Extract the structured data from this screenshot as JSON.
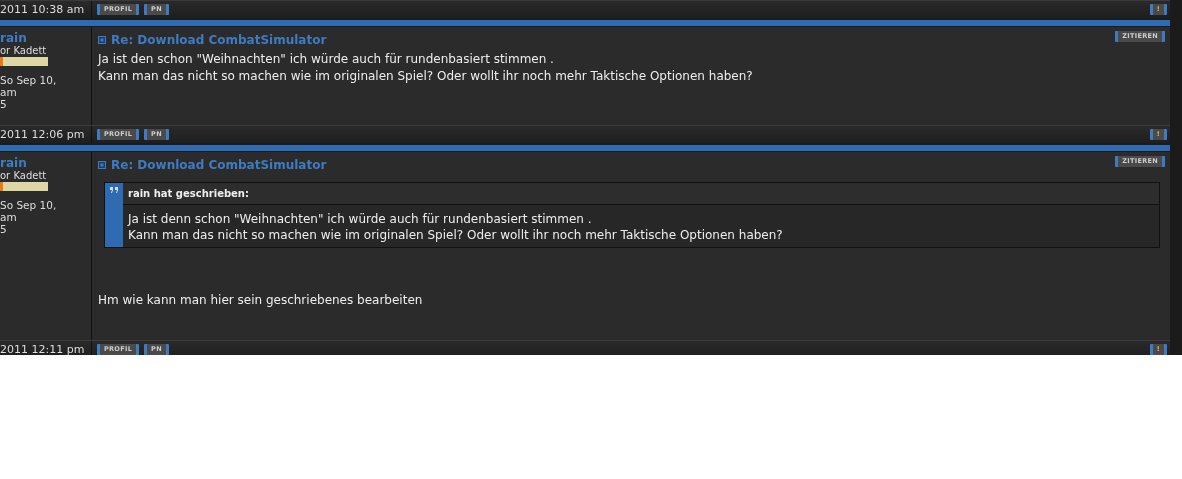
{
  "top_footer": {
    "date": "2011 10:38 am",
    "buttons": [
      "PROFIL",
      "PN"
    ],
    "report": "!"
  },
  "posts": [
    {
      "author": {
        "name": "rain",
        "rank": "or Kadett",
        "joined": [
          "So Sep 10,",
          "am",
          "5"
        ]
      },
      "title": "Re: Download CombatSimulator",
      "quote_button": "ZITIEREN",
      "body": [
        "Ja ist den schon \"Weihnachten\" ich würde auch für rundenbasiert stimmen .",
        "Kann man das nicht so machen wie im originalen Spiel? Oder wollt ihr noch mehr Taktische Optionen haben?"
      ],
      "footer": {
        "date": "2011 12:06 pm",
        "buttons": [
          "PROFIL",
          "PN"
        ],
        "report": "!"
      }
    },
    {
      "author": {
        "name": "rain",
        "rank": "or Kadett",
        "joined": [
          "So Sep 10,",
          "am",
          "5"
        ]
      },
      "title": "Re: Download CombatSimulator",
      "quote_button": "ZITIEREN",
      "quote": {
        "header": "rain hat geschrieben:",
        "lines": [
          "Ja ist denn schon \"Weihnachten\" ich würde auch für rundenbasiert stimmen .",
          "Kann man das nicht so machen wie im originalen Spiel? Oder wollt ihr noch mehr Taktische Optionen haben?"
        ]
      },
      "body": [
        "Hm wie kann man hier sein geschriebenes bearbeiten"
      ],
      "footer": {
        "date": "2011 12:11 pm",
        "buttons": [
          "PROFIL",
          "PN"
        ],
        "report": "!"
      }
    }
  ]
}
